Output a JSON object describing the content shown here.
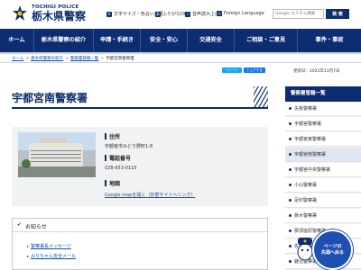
{
  "header": {
    "logo_en": "TOCHIGI POLICE",
    "logo_ja": "栃木県警察",
    "util": [
      {
        "icon": "text-size-icon",
        "label": "文字サイズ・色合い変更"
      },
      {
        "icon": "furigana-icon",
        "label": "ふりがなON"
      },
      {
        "icon": "speaker-icon",
        "label": "音声読み上げ"
      },
      {
        "icon": "globe-icon",
        "label": "Foreign Language"
      }
    ],
    "search_placeholder": "Google カスタム検索",
    "search_label": "検 索"
  },
  "nav": [
    "ホーム",
    "栃木県警察の紹介",
    "申請・手続き",
    "安全・安心",
    "交通安全",
    "ご相談・ご意見",
    "事件・事故"
  ],
  "breadcrumb": [
    "ホーム",
    "栃木県警察の紹介",
    "警察署管轄一覧",
    "宇都宮南警察署"
  ],
  "share": {
    "twitter": "ツイート",
    "facebook": "シェアする"
  },
  "updated": "更新日：2022年11月7日",
  "page_title": "宇都宮南警察署",
  "info": {
    "address_label": "住所",
    "address": "宇都宮市みどり野町1-8",
    "phone_label": "電話番号",
    "phone": "028-653-0110",
    "map_label": "地図",
    "map_link": "Google mapを開く（外部サイトへリンク）"
  },
  "notice": {
    "title": "お知らせ",
    "items": [
      "警察署長メッセージ",
      "みりちゃん安全メール"
    ]
  },
  "sidebar": {
    "title": "警察署管轄一覧",
    "items": [
      "矢板警察署",
      "宇都宮警察署",
      "宇都宮東警察署",
      "宇都宮南警察署",
      "宇都宮中央警察署",
      "小山警察署",
      "足利警察署",
      "栃木警察署",
      "那須塩原警察署",
      "佐野警察署",
      "鹿沼警察署"
    ],
    "active_index": 3
  },
  "mascot": {
    "label": "ページの\n先頭へ戻る"
  },
  "colors": {
    "brand": "#0c2d72",
    "link": "#1a4fa0",
    "mascot": "#1e4fb3"
  }
}
